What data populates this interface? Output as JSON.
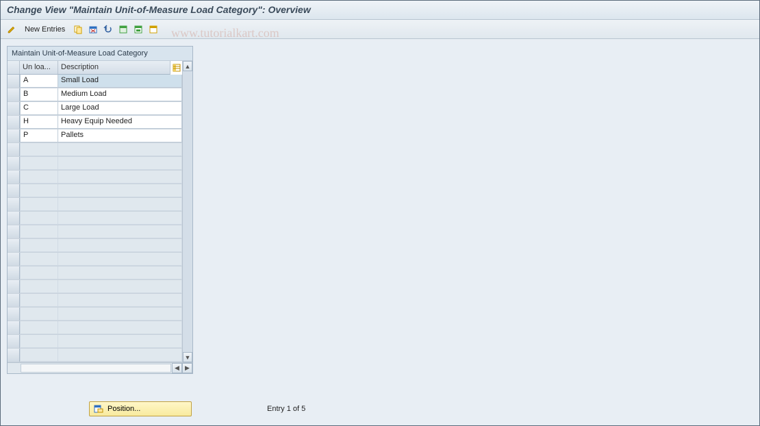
{
  "title": "Change View \"Maintain Unit-of-Measure Load Category\": Overview",
  "toolbar": {
    "new_entries": "New Entries"
  },
  "watermark": "www.tutorialkart.com",
  "panel": {
    "title": "Maintain Unit-of-Measure Load Category",
    "columns": {
      "code": "Un loa...",
      "desc": "Description"
    }
  },
  "rows": [
    {
      "code": "A",
      "desc": "Small Load",
      "selected": true
    },
    {
      "code": "B",
      "desc": "Medium Load",
      "selected": false
    },
    {
      "code": "C",
      "desc": "Large Load",
      "selected": false
    },
    {
      "code": "H",
      "desc": "Heavy Equip Needed",
      "selected": false
    },
    {
      "code": "P",
      "desc": "Pallets",
      "selected": false
    }
  ],
  "empty_row_count": 16,
  "position_button": "Position...",
  "entry_status": "Entry 1 of 5"
}
